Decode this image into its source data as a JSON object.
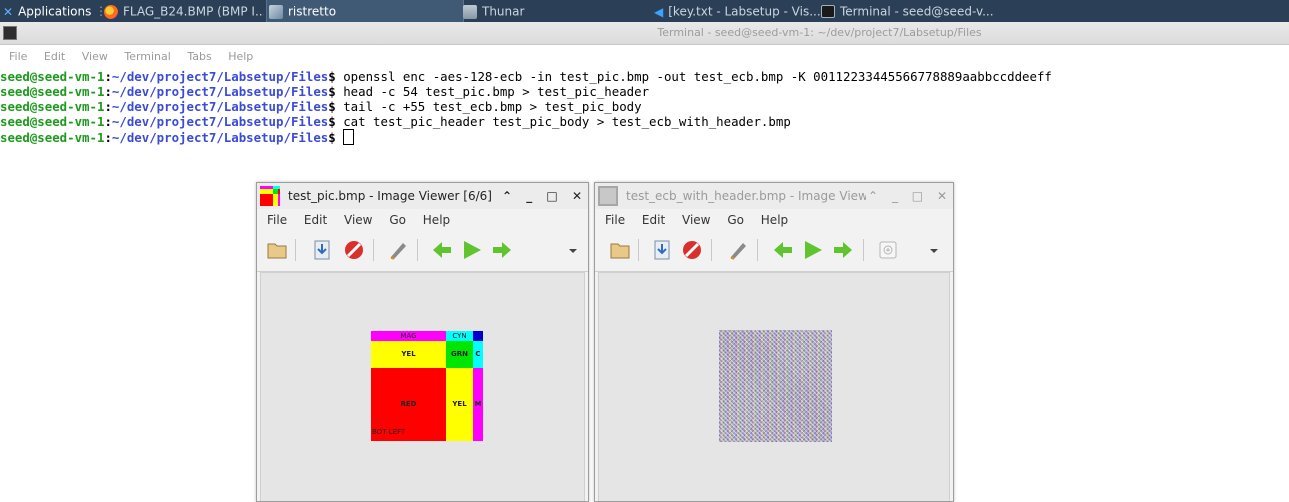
{
  "taskbar": {
    "applications": "Applications",
    "separator": "⋮",
    "items": [
      {
        "label": "FLAG_B24.BMP (BMP I..."
      },
      {
        "label": "ristretto"
      },
      {
        "label": "Thunar"
      },
      {
        "label": "[key.txt - Labsetup - Vis..."
      },
      {
        "label": "Terminal - seed@seed-v..."
      }
    ]
  },
  "terminal": {
    "title": "Terminal - seed@seed-vm-1: ~/dev/project7/Labsetup/Files",
    "menu": [
      "File",
      "Edit",
      "View",
      "Terminal",
      "Tabs",
      "Help"
    ],
    "prompt_user": "seed@seed-vm-1",
    "prompt_path": "~/dev/project7/Labsetup/Files",
    "prompt_symbol": "$",
    "lines": [
      {
        "command": "openssl enc -aes-128-ecb -in test_pic.bmp -out test_ecb.bmp -K 00112233445566778889aabbccddeeff"
      },
      {
        "command": "head -c 54 test_pic.bmp > test_pic_header"
      },
      {
        "command": "tail -c +55 test_ecb.bmp > test_pic_body"
      },
      {
        "command": "cat test_pic_header test_pic_body > test_ecb_with_header.bmp"
      },
      {
        "command": ""
      }
    ]
  },
  "viewer_left": {
    "title": "test_pic.bmp - Image Viewer [6/6]",
    "menu": [
      "File",
      "Edit",
      "View",
      "Go",
      "Help"
    ],
    "image_labels": {
      "mag": "MAG",
      "cyn": "CYN",
      "yel_top": "YEL",
      "grn": "GRN",
      "c": "C",
      "red": "RED",
      "yel_mid": "YEL",
      "m": "M",
      "bot_left": "BOT LEFT"
    }
  },
  "viewer_right": {
    "title": "test_ecb_with_header.bmp - Image View",
    "menu": [
      "File",
      "Edit",
      "View",
      "Go",
      "Help"
    ]
  },
  "colors": {
    "taskbar": "#2b4057",
    "prompt_user": "#1c9b1c",
    "prompt_path": "#3b4bd8",
    "magenta": "#ff00ff",
    "cyan": "#00ffff",
    "yellow": "#ffff00",
    "green": "#00e600",
    "red": "#ff0000",
    "blue": "#0000cc"
  }
}
